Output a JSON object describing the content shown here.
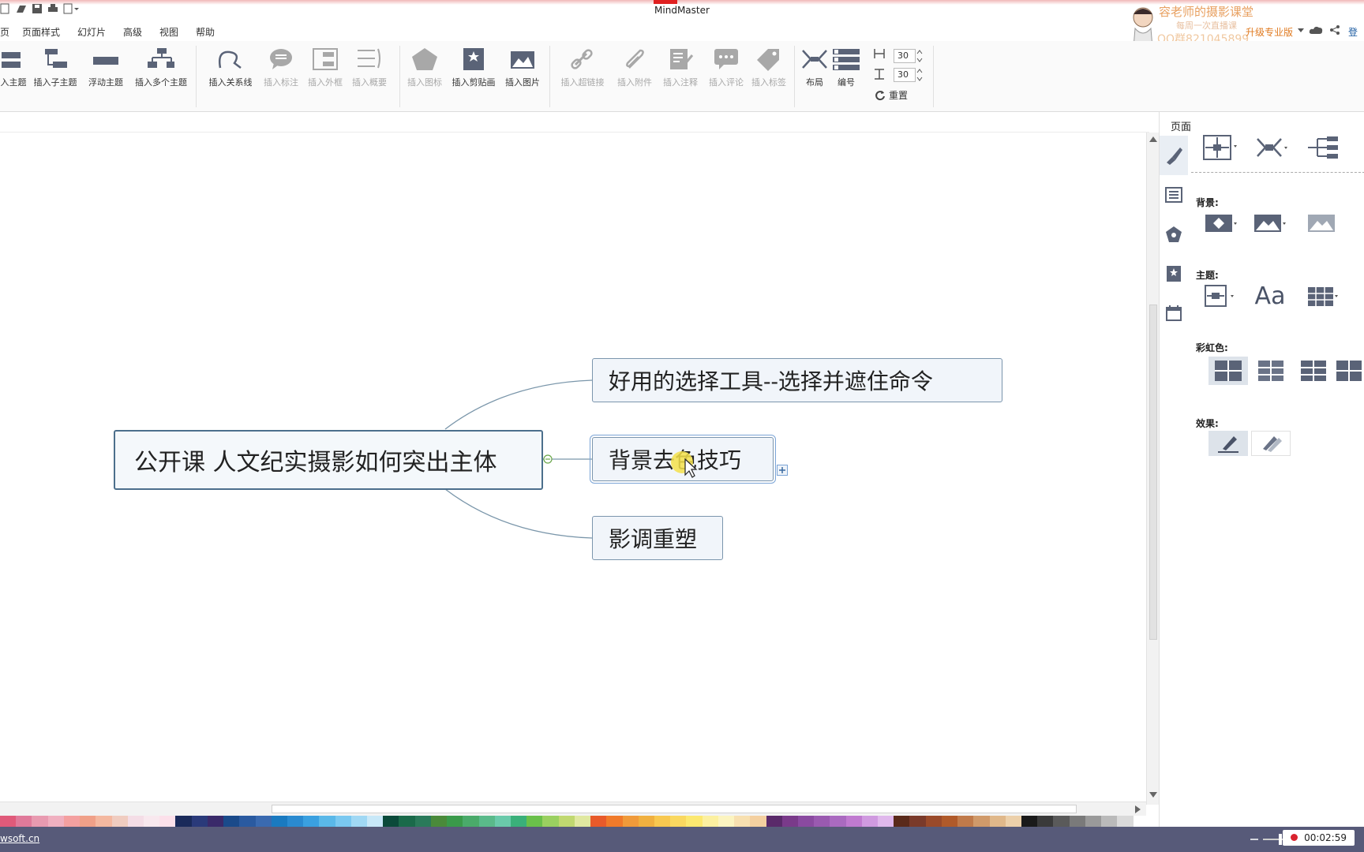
{
  "app": {
    "title": "MindMaster"
  },
  "menu": {
    "items": [
      "页",
      "页面样式",
      "幻灯片",
      "高级",
      "视图",
      "帮助"
    ]
  },
  "ribbon": {
    "insert_topic": "入主题",
    "insert_subtopic": "插入子主题",
    "floating_topic": "浮动主题",
    "multi_topic": "插入多个主题",
    "relation": "插入关系线",
    "callout": "插入标注",
    "boundary": "插入外框",
    "summary": "插入概要",
    "icon": "插入图标",
    "clipart": "插入剪贴画",
    "image": "插入图片",
    "hyperlink": "插入超链接",
    "attachment": "插入附件",
    "note": "插入注释",
    "comment": "插入评论",
    "tag": "插入标签",
    "layout": "布局",
    "numbering": "编号",
    "spacing_h": "30",
    "spacing_v": "30",
    "reset": "重置"
  },
  "header_right": {
    "upgrade": "升级专业版",
    "login": "登录"
  },
  "watermark": {
    "line1": "容老师的摄影课堂",
    "line2": "每周一次直播课",
    "line3": "QQ群821045899"
  },
  "mindmap": {
    "central": "公开课 人文纪实摄影如何突出主体",
    "branches": [
      "好用的选择工具--选择并遮住命令",
      "背景去色技巧",
      "影调重塑"
    ]
  },
  "right_panel": {
    "title": "页面",
    "background_label": "背景:",
    "theme_label": "主题:",
    "rainbow_label": "彩虹色:",
    "effect_label": "效果:",
    "font_glyph": "Aa"
  },
  "status": {
    "link": "wsoft.cn",
    "timer": "00:02:59"
  },
  "colors": {
    "accent": "#4c6f8c",
    "status_bg": "#575a79",
    "palette": [
      "#e05a7a",
      "#e07a9a",
      "#e89ab0",
      "#f0b0c0",
      "#f4a0a0",
      "#f0a088",
      "#f4b8a0",
      "#f0ccc0",
      "#f4dde6",
      "#f8e8ee",
      "#fce0ea",
      "#1a2a5a",
      "#2a3a7a",
      "#3a2a6a",
      "#1a4a8a",
      "#2a5aa0",
      "#3a6ab0",
      "#1a7ac0",
      "#2a8ad0",
      "#3aa0e0",
      "#5ab8e8",
      "#7ac8f0",
      "#a0d8f4",
      "#c8e8f8",
      "#0a4a3a",
      "#1a6a4a",
      "#2a7a5a",
      "#4a8a3a",
      "#3a9a4a",
      "#4aaa6a",
      "#5aba8a",
      "#6acaaa",
      "#3ab07a",
      "#6ac04a",
      "#9ad060",
      "#c0d870",
      "#e0e8a0",
      "#e85a2a",
      "#f07a2a",
      "#f09a3a",
      "#f0b040",
      "#f8c850",
      "#fad860",
      "#fce870",
      "#fcf0a0",
      "#fcf4c0",
      "#f8e0b0",
      "#f4d0a0",
      "#5a2a6a",
      "#7a3a8a",
      "#8a4aa0",
      "#9a5ab0",
      "#aa6ac0",
      "#c07ad0",
      "#d09ae0",
      "#e0b8ec",
      "#5a2a1a",
      "#7a3a2a",
      "#9a4a2a",
      "#b05a2a",
      "#c07a4a",
      "#d09a6a",
      "#e0b88a",
      "#ecd0aa",
      "#1a1a1a",
      "#3a3a3a",
      "#5a5a5a",
      "#7a7a7a",
      "#9a9a9a",
      "#bababa",
      "#dadada",
      "#ffffff"
    ]
  }
}
